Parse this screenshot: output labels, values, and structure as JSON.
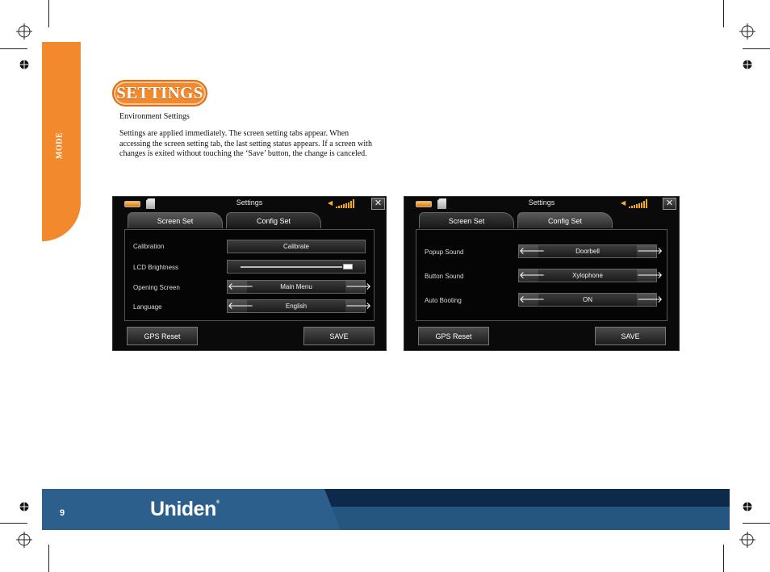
{
  "side_tab": {
    "label": "MODE"
  },
  "heading": {
    "title": "SETTINGS"
  },
  "section": {
    "subheading": "Environment Settings",
    "body": "Settings are applied immediately. The screen setting tabs appear. When accessing the screen setting tab, the last setting status appears. If a screen with changes is exited without touching the ‘Save’ button, the change is canceled."
  },
  "screen_left": {
    "title": "Settings",
    "tabs": [
      {
        "label": "Screen Set",
        "active": true
      },
      {
        "label": "Config Set",
        "active": false
      }
    ],
    "rows": [
      {
        "label": "Calibration",
        "button": "Calibrate"
      },
      {
        "label": "LCD Brightness",
        "slider_fraction": 0.95
      },
      {
        "label": "Opening Screen",
        "value": "Main Menu"
      },
      {
        "label": "Language",
        "value": "English"
      }
    ],
    "gps_reset": "GPS Reset",
    "save": "SAVE",
    "close": "✕"
  },
  "screen_right": {
    "title": "Settings",
    "tabs": [
      {
        "label": "Screen Set",
        "active": false
      },
      {
        "label": "Config Set",
        "active": true
      }
    ],
    "rows": [
      {
        "label": "Popup Sound",
        "value": "Doorbell"
      },
      {
        "label": "Button Sound",
        "value": "Xylophone"
      },
      {
        "label": "Auto Booting",
        "value": "ON"
      }
    ],
    "gps_reset": "GPS Reset",
    "save": "SAVE",
    "close": "✕"
  },
  "arrows": {
    "left": "🡐",
    "right": "🡒"
  },
  "footer": {
    "page_number": "9",
    "brand": "Uniden",
    "brand_mark": "®"
  },
  "colors": {
    "accent_orange": "#f2892c",
    "footer_navy": "#0e2a4a",
    "footer_blue": "#2d5f8d"
  }
}
